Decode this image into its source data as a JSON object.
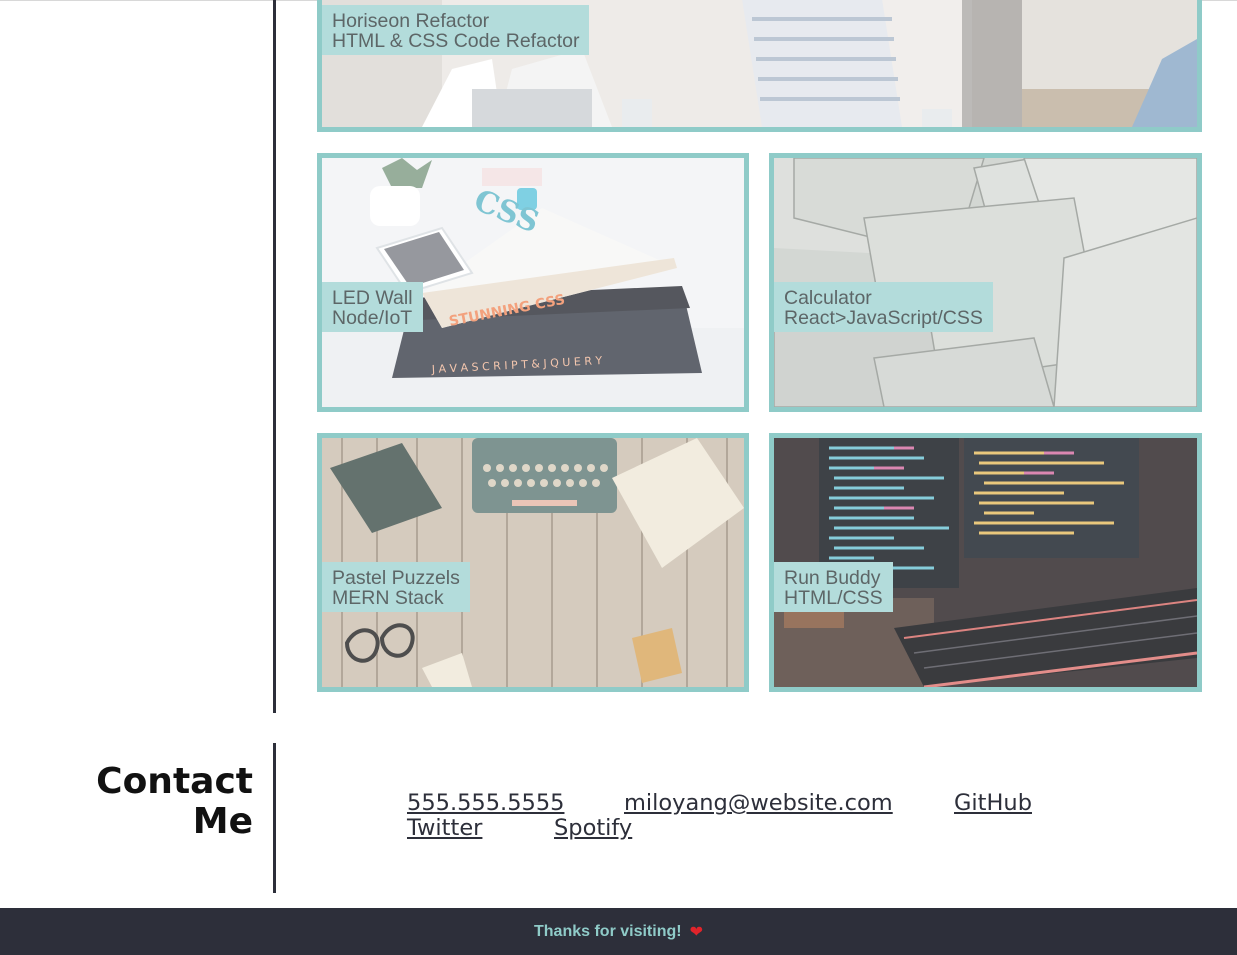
{
  "projects": [
    {
      "title": "Horiseon Refactor",
      "tech": "HTML & CSS Code Refactor",
      "image": "team-meeting-photo"
    },
    {
      "title": "LED Wall",
      "tech": "Node/IoT",
      "image": "books-and-phone-photo"
    },
    {
      "title": "Calculator",
      "tech": "React>JavaScript/CSS",
      "image": "paper-sheets-photo"
    },
    {
      "title": "Pastel Puzzels",
      "tech": "MERN Stack",
      "image": "typewriter-desk-photo"
    },
    {
      "title": "Run Buddy",
      "tech": "HTML/CSS",
      "image": "code-monitors-photo"
    }
  ],
  "contact": {
    "title_line1": "Contact",
    "title_line2": "Me",
    "links": [
      "555.555.5555",
      "miloyang@website.com",
      "GitHub",
      "Twitter",
      "Spotify"
    ]
  },
  "footer": {
    "text": "Thanks for visiting!",
    "icon": "heart-icon",
    "icon_glyph": "❤"
  },
  "colors": {
    "card_border": "#8fcbc8",
    "label_bg": "#b3dcdb",
    "label_text": "#5d6667",
    "dark": "#2d2f3a",
    "footer_text": "#8fcbc8",
    "heart": "#e0242b"
  }
}
